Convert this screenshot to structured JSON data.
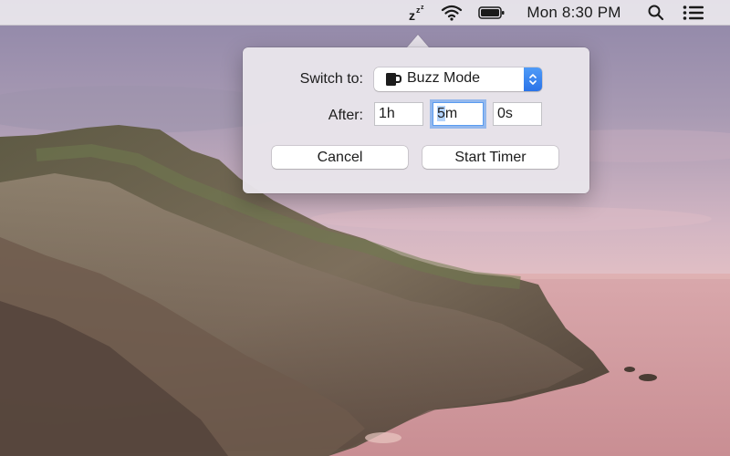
{
  "menubar": {
    "clock": "Mon 8:30 PM",
    "icons": {
      "sleep": "zzz-icon",
      "wifi": "wifi-icon",
      "battery": "battery-icon",
      "search": "search-icon",
      "list": "list-icon"
    }
  },
  "popover": {
    "switch_label": "Switch to:",
    "mode": {
      "icon": "mug-icon",
      "value": "Buzz Mode"
    },
    "after_label": "After:",
    "fields": {
      "hours": "1h",
      "minutes_selected": "5",
      "minutes_rest": "m",
      "seconds": "0s"
    },
    "buttons": {
      "cancel": "Cancel",
      "start": "Start Timer"
    }
  },
  "colors": {
    "accent": "#2a73e8",
    "focus_ring": "#5a9cf0",
    "selection": "#b3d3fb"
  }
}
